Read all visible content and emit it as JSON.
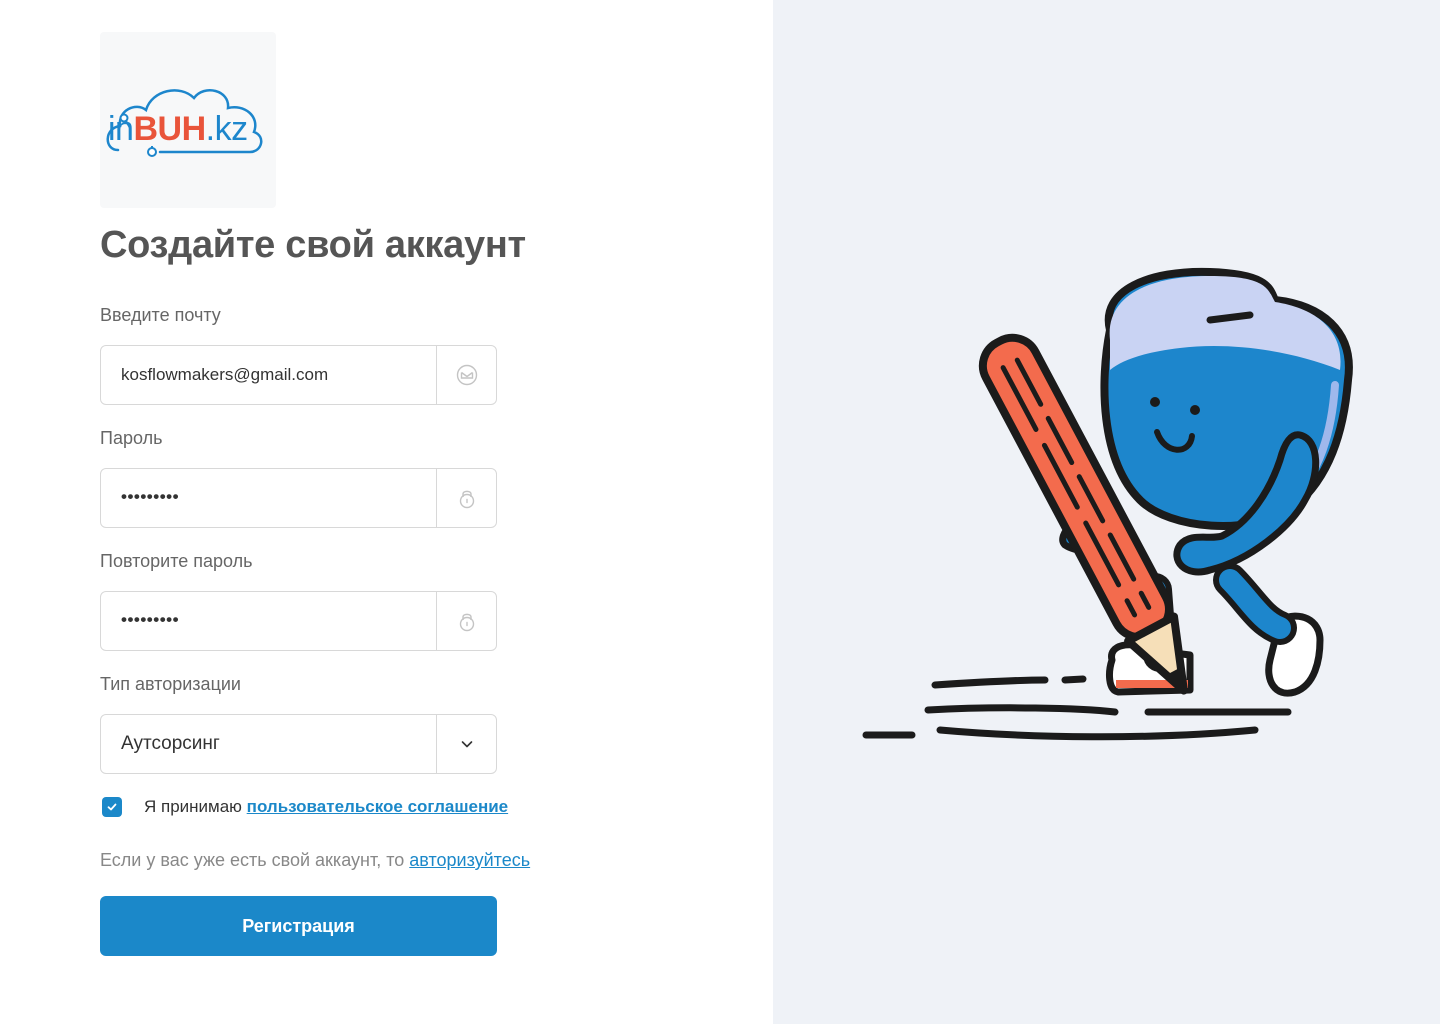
{
  "logo": {
    "prefix": "in",
    "brand": "BUH",
    "suffix": ".kz"
  },
  "page_title": "Создайте свой аккаунт",
  "form": {
    "email": {
      "label": "Введите почту",
      "value": "kosflowmakers@gmail.com",
      "icon": "mail-icon"
    },
    "password": {
      "label": "Пароль",
      "value": "•••••••••",
      "icon": "lock-icon"
    },
    "repeat_password": {
      "label": "Повторите пароль",
      "value": "•••••••••",
      "icon": "lock-icon"
    },
    "auth_type": {
      "label": "Тип авторизации",
      "value": "Аутсорсинг",
      "icon": "chevron-down-icon"
    },
    "agreement": {
      "checked": true,
      "text": "Я принимаю",
      "link": "пользовательское соглашение"
    },
    "login_prompt": {
      "text": "Если у вас уже есть свой аккаунт, то",
      "link": "авторизуйтесь"
    },
    "submit_label": "Регистрация"
  },
  "colors": {
    "accent": "#1b88c9",
    "brand_red": "#e9543a",
    "right_panel_bg": "#eff2f7"
  }
}
